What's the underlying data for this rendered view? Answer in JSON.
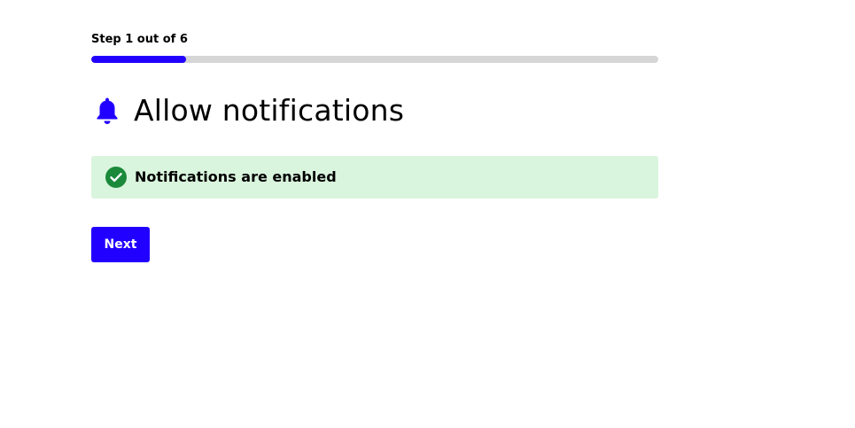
{
  "progress": {
    "label": "Step 1 out of 6",
    "current_step": 1,
    "total_steps": 6
  },
  "header": {
    "icon": "bell-icon",
    "title": "Allow notifications"
  },
  "status": {
    "icon": "check-circle-icon",
    "text": "Notifications are enabled"
  },
  "actions": {
    "next_label": "Next"
  },
  "colors": {
    "accent": "#2200ff",
    "progress_track": "#d6d6d6",
    "success_bg": "#d9f5dd",
    "success_icon": "#1a8a3a",
    "text": "#000000",
    "button_text": "#ffffff"
  }
}
